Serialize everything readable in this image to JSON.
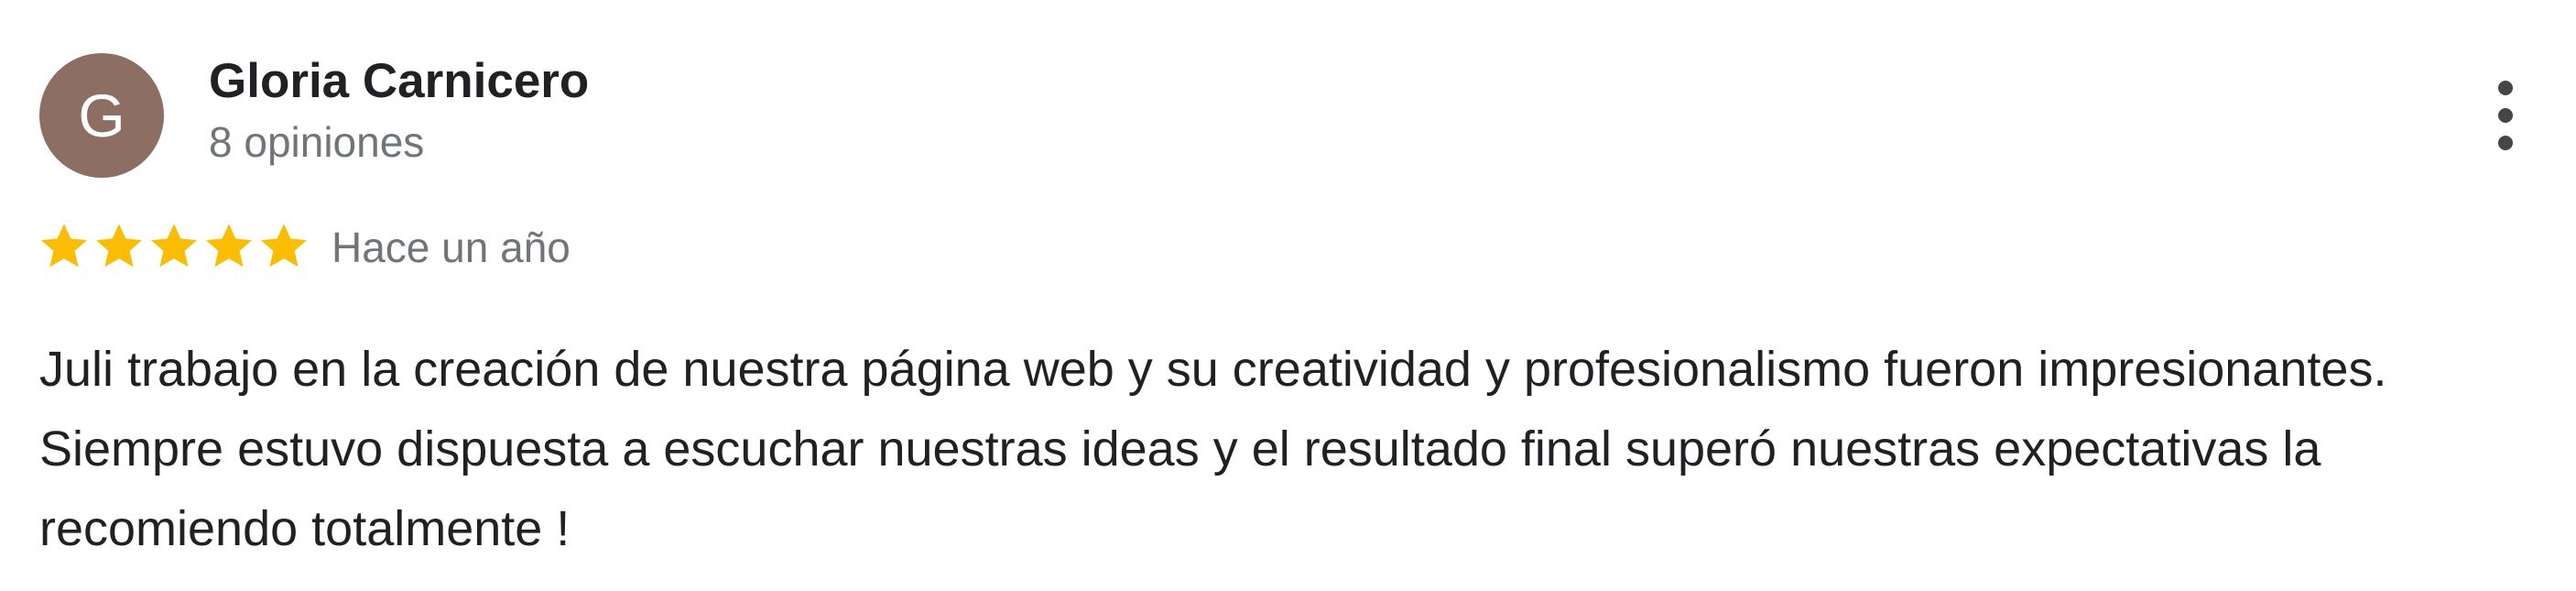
{
  "review": {
    "author": {
      "initial": "G",
      "name": "Gloria Carnicero",
      "reviews_count": "8 opiniones",
      "avatar_color": "#8d6e63"
    },
    "rating": 5,
    "rating_max": 5,
    "star_color": "#fbbc04",
    "date": "Hace un año",
    "text": "Juli trabajo en la creación de nuestra página web y su creatividad y profesionalismo fueron impresionantes. Siempre estuvo dispuesta a escuchar nuestras ideas y el resultado final superó nuestras expectativas la recomiendo totalmente !",
    "menu_icon": "more-vert-icon"
  }
}
